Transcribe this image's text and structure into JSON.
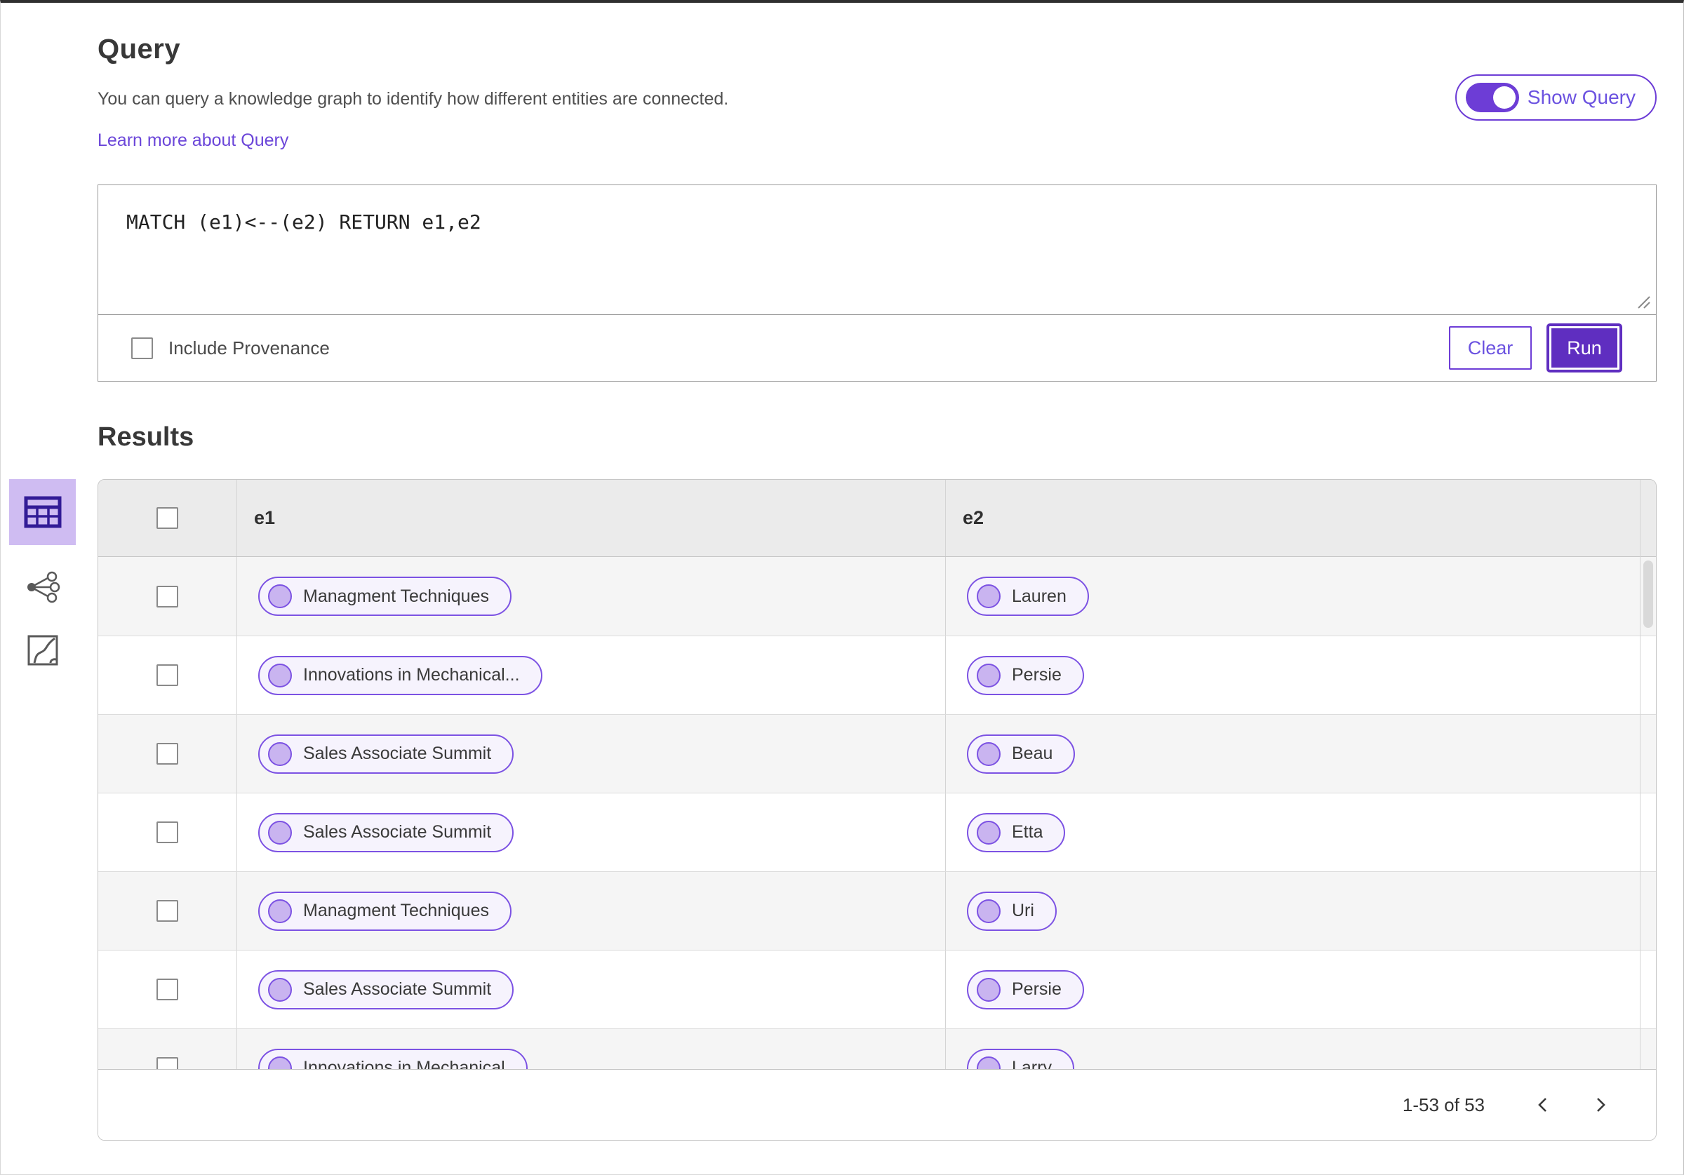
{
  "colors": {
    "accent_purple": "#6d3dd6",
    "run_button_fill": "#5f2ec0",
    "pill_border": "#7c52e3",
    "pill_fill": "#f6f3fd",
    "pill_circle_fill": "#c9b4f0",
    "selected_view_bg": "#cfbcf2",
    "table_header_bg": "#ebebeb",
    "row_stripe_bg": "#f5f5f5",
    "link_purple": "#6b46d9"
  },
  "query_section": {
    "title": "Query",
    "description": "You can query a knowledge graph to identify how different entities are connected.",
    "learn_more_label": "Learn more about Query",
    "show_query_label": "Show Query",
    "show_query_state": "on",
    "query_text": "MATCH (e1)<--(e2) RETURN e1,e2",
    "include_provenance_label": "Include Provenance",
    "include_provenance_checked": false,
    "clear_label": "Clear",
    "run_label": "Run"
  },
  "results_section": {
    "title": "Results",
    "view_icons": [
      "table-view-icon",
      "graph-view-icon",
      "chart-view-icon"
    ],
    "selected_view": "table-view-icon",
    "table": {
      "columns": [
        "e1",
        "e2"
      ],
      "rows": [
        {
          "e1": "Managment Techniques",
          "e2": "Lauren"
        },
        {
          "e1": "Innovations in Mechanical...",
          "e2": "Persie"
        },
        {
          "e1": "Sales Associate Summit",
          "e2": "Beau"
        },
        {
          "e1": "Sales Associate Summit",
          "e2": "Etta"
        },
        {
          "e1": "Managment Techniques",
          "e2": "Uri"
        },
        {
          "e1": "Sales Associate Summit",
          "e2": "Persie"
        },
        {
          "e1": "Innovations in Mechanical",
          "e2": "Larry"
        }
      ]
    },
    "pagination": {
      "range_text": "1-53 of 53"
    }
  }
}
